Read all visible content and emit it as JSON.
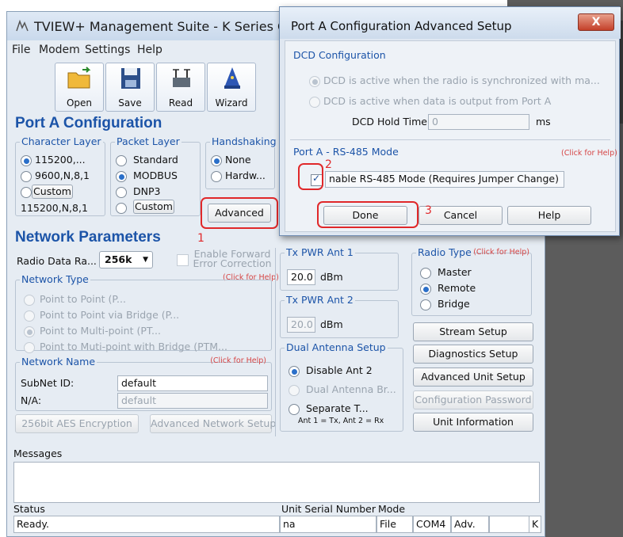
{
  "app": {
    "title": "TVIEW+ Management Suite - K Series Configu"
  },
  "menu": [
    "File",
    "Modem",
    "Settings",
    "Help"
  ],
  "toolbar": {
    "open": "Open",
    "save": "Save",
    "read": "Read",
    "wizard": "Wizard"
  },
  "port_a": {
    "title": "Port A Configuration",
    "character_layer": {
      "label": "Character Layer",
      "options": [
        "115200,...",
        "9600,N,8,1"
      ],
      "custom": "Custom",
      "value": "115200,N,8,1"
    },
    "packet_layer": {
      "label": "Packet Layer",
      "options": [
        "Standard",
        "MODBUS",
        "DNP3"
      ],
      "custom": "Custom"
    },
    "handshaking": {
      "label": "Handshaking",
      "options": [
        "None",
        "Hardw..."
      ]
    },
    "advanced_button": "Advanced"
  },
  "network": {
    "title": "Network Parameters",
    "radio_data_rate_label": "Radio Data Ra...",
    "radio_data_rate_value": "256k",
    "fec_label": "Enable Forward Error Correction",
    "fec_help": "(Click for Help)",
    "network_type": {
      "label": "Network Type",
      "help": "(Click for Help)",
      "options": [
        "Point to Point (P...",
        "Point to Point via Bridge (P...",
        "Point to Multi-point (PT...",
        "Point to Muti-point with Bridge (PTM..."
      ]
    },
    "network_name": {
      "label": "Network Name",
      "help": "(Click for Help)",
      "subnet_label": "SubNet ID:",
      "subnet_value": "default",
      "na_label": "N/A:",
      "na_value": "default"
    },
    "aes_button": "256bit AES Encryption",
    "adv_net_button": "Advanced Network Setup"
  },
  "tx": {
    "ant1_label": "Tx PWR Ant 1",
    "ant1_value": "20.0",
    "ant1_unit": "dBm",
    "ant2_label": "Tx PWR Ant 2",
    "ant2_value": "20.0",
    "ant2_unit": "dBm",
    "dual": {
      "label": "Dual Antenna Setup",
      "options": [
        "Disable Ant 2",
        "Dual Antenna Br...",
        "Separate T..."
      ],
      "note": "Ant 1 = Tx, Ant 2 = Rx"
    }
  },
  "radio_type": {
    "label": "Radio Type",
    "help": "(Click for Help)",
    "options": [
      "Master",
      "Remote",
      "Bridge"
    ]
  },
  "side_buttons": [
    "Stream Setup",
    "Diagnostics Setup",
    "Advanced Unit Setup",
    "Configuration Password",
    "Unit Information"
  ],
  "messages_label": "Messages",
  "status": {
    "label": "Status",
    "serial_label": "Unit Serial Number",
    "mode_label": "Mode",
    "state": "Ready.",
    "serial": "na",
    "mode": "File",
    "port": "COM4",
    "adv": "Adv.",
    "k": "K"
  },
  "dialog": {
    "title": "Port A Configuration Advanced Setup",
    "close": "X",
    "dcd_label": "DCD Configuration",
    "dcd_opt1": "DCD is active when the radio is synchronized with ma...",
    "dcd_opt2": "DCD is active when data is output from Port A",
    "dcd_hold_label": "DCD Hold Time",
    "dcd_hold_value": "0",
    "dcd_hold_unit": "ms",
    "rs485_label": "Port A - RS-485 Mode",
    "rs485_help": "(Click for Help)",
    "rs485_check": "nable RS-485 Mode (Requires Jumper Change)",
    "done": "Done",
    "cancel": "Cancel",
    "help": "Help"
  },
  "annotations": {
    "one": "1",
    "two": "2",
    "three": "3"
  },
  "colors": {
    "heading": "#1c54a8",
    "annotation": "#e0282a",
    "help_link": "#d64545"
  }
}
